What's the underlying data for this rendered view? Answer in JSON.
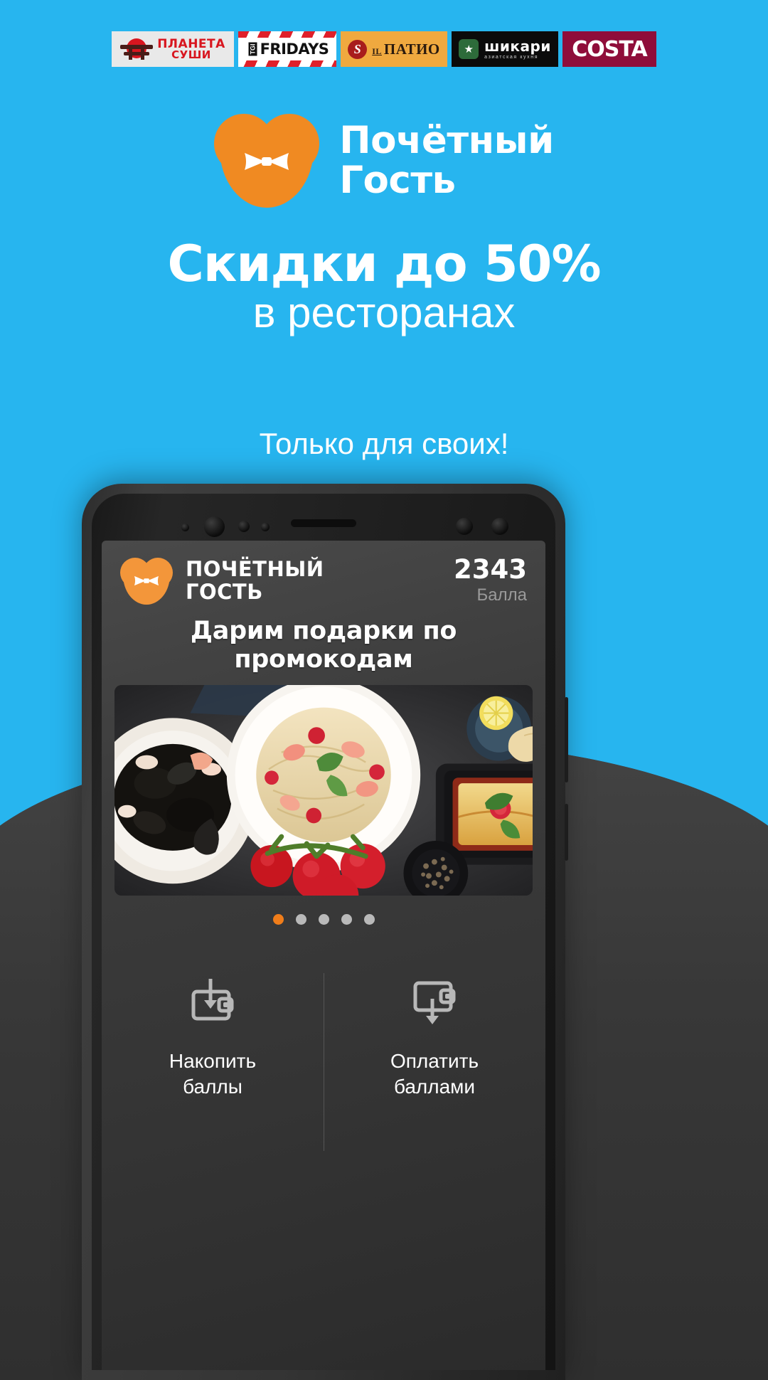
{
  "theme": {
    "background": "#27b5ef",
    "accent": "#f08a22",
    "dark_panel": "#3a3a3a",
    "text_white": "#ffffff"
  },
  "brand_strip": {
    "logos": [
      {
        "name": "planeta-sushi",
        "line1": "ПЛАНЕТА",
        "line2": "СУШИ",
        "bg": "#e9e9e9",
        "fg": "#d8161f"
      },
      {
        "name": "tgi-fridays",
        "prefix": "TGI",
        "title": "FRIDAYS",
        "bg": "#ffffff",
        "fg": "#111111"
      },
      {
        "name": "il-patio",
        "prefix": "IL",
        "title": "ПАТИО",
        "bg": "#f0a93f",
        "fg": "#2a1a0e"
      },
      {
        "name": "shikari",
        "title": "шикари",
        "subtitle": "азиатская кухня",
        "bg": "#0b0b0b",
        "fg": "#ffffff"
      },
      {
        "name": "costa",
        "title": "COSTA",
        "bg": "#8f0d3a",
        "fg": "#ffffff"
      }
    ]
  },
  "hero": {
    "logo_alt": "heart-bowtie-logo",
    "brand_line1": "Почётный",
    "brand_line2": "Гость",
    "headline": "Скидки до 50%",
    "subheadline": "в ресторанах",
    "tagline": "Только для своих!"
  },
  "phone": {
    "app": {
      "brand_line1": "ПОЧЁТНЫЙ",
      "brand_line2": "ГОСТЬ",
      "points_value": "2343",
      "points_unit": "Балла",
      "promo_title": "Дарим подарки по промокодам",
      "carousel": {
        "image_alt": "food-photo-pasta-mussels-lasagna",
        "dots_total": 5,
        "active_dot": 1
      },
      "actions": [
        {
          "icon": "wallet-in-icon",
          "line1": "Накопить",
          "line2": "баллы"
        },
        {
          "icon": "wallet-out-icon",
          "line1": "Оплатить",
          "line2": "баллами"
        }
      ]
    }
  }
}
